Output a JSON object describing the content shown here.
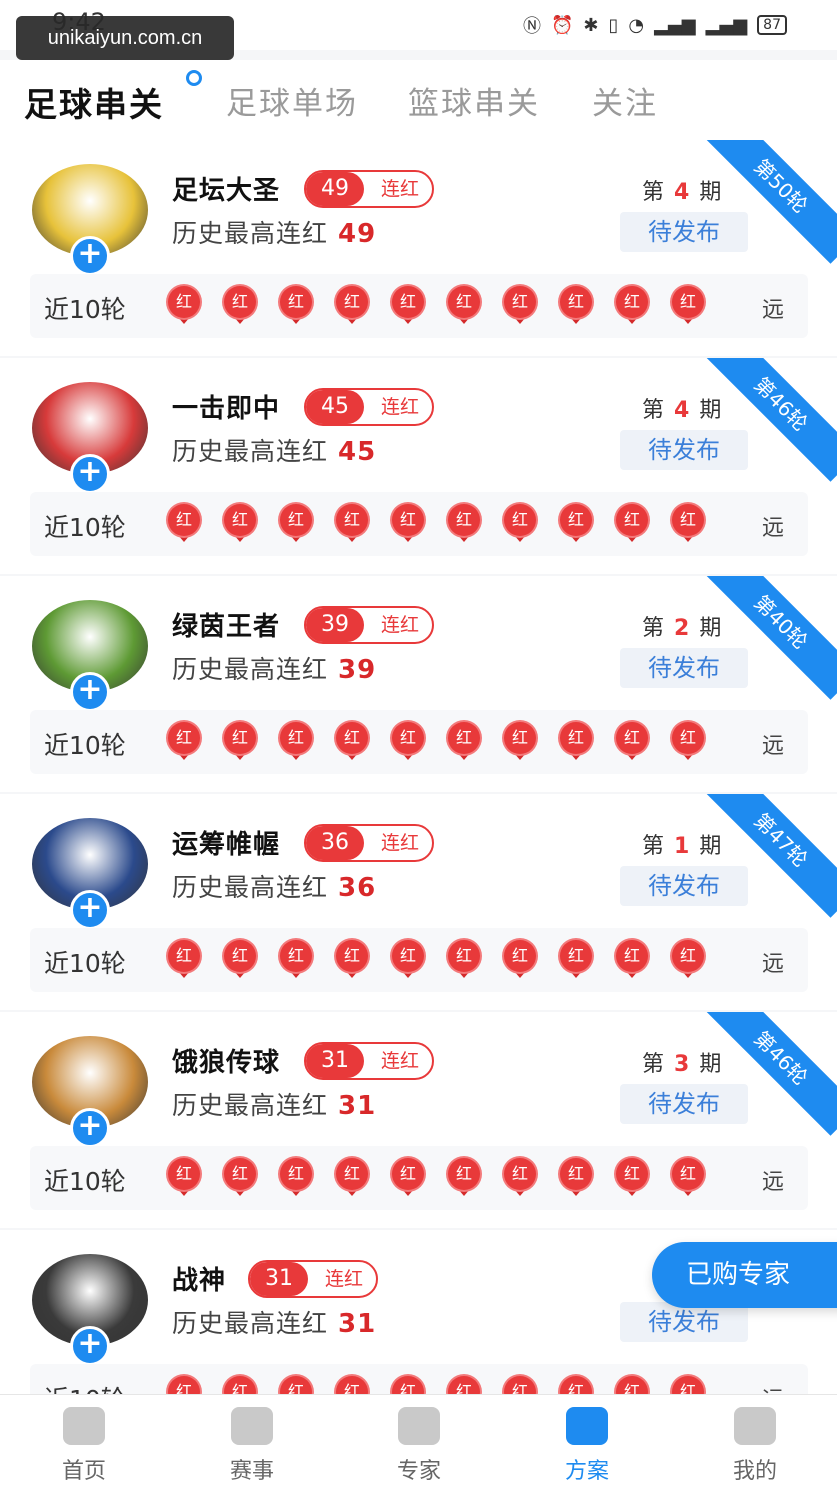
{
  "status": {
    "time": "9:42",
    "icons": [
      "nfc-icon",
      "alarm-icon",
      "bluetooth-icon",
      "vibrate-icon",
      "wifi-icon",
      "signal-icon",
      "signal-icon"
    ],
    "battery": "87"
  },
  "watermark": "unikaiyun.com.cn",
  "tabs": [
    {
      "label": "足球串关"
    },
    {
      "label": "足球单场"
    },
    {
      "label": "篮球串关"
    },
    {
      "label": "关注"
    }
  ],
  "labels": {
    "streak_suffix": "连红",
    "history_prefix": "历史最高连红",
    "period_prefix": "第",
    "period_suffix": "期",
    "pending": "待发布",
    "recent": "近10轮",
    "badge": "红",
    "far": "远"
  },
  "experts": [
    {
      "name": "足坛大圣",
      "streak": "49",
      "history": "49",
      "period": "4",
      "ribbon": "第50轮",
      "avatar_color": "#e7c23a"
    },
    {
      "name": "一击即中",
      "streak": "45",
      "history": "45",
      "period": "4",
      "ribbon": "第46轮",
      "avatar_color": "#d73a3a"
    },
    {
      "name": "绿茵王者",
      "streak": "39",
      "history": "39",
      "period": "2",
      "ribbon": "第40轮",
      "avatar_color": "#5e9a34"
    },
    {
      "name": "运筹帷幄",
      "streak": "36",
      "history": "36",
      "period": "1",
      "ribbon": "第47轮",
      "avatar_color": "#2b4a8c"
    },
    {
      "name": "饿狼传球",
      "streak": "31",
      "history": "31",
      "period": "3",
      "ribbon": "第46轮",
      "avatar_color": "#c98a3b"
    },
    {
      "name": "战神",
      "streak": "31",
      "history": "31",
      "period": "",
      "ribbon": "",
      "avatar_color": "#3a3a3a"
    }
  ],
  "floating": {
    "bought": "已购专家"
  },
  "nav": [
    {
      "label": "首页",
      "icon": "home-icon"
    },
    {
      "label": "赛事",
      "icon": "trophy-icon"
    },
    {
      "label": "专家",
      "icon": "expert-icon"
    },
    {
      "label": "方案",
      "icon": "plan-icon"
    },
    {
      "label": "我的",
      "icon": "profile-icon"
    }
  ],
  "colors": {
    "accent": "#1e8bf0",
    "red": "#e8393a"
  }
}
